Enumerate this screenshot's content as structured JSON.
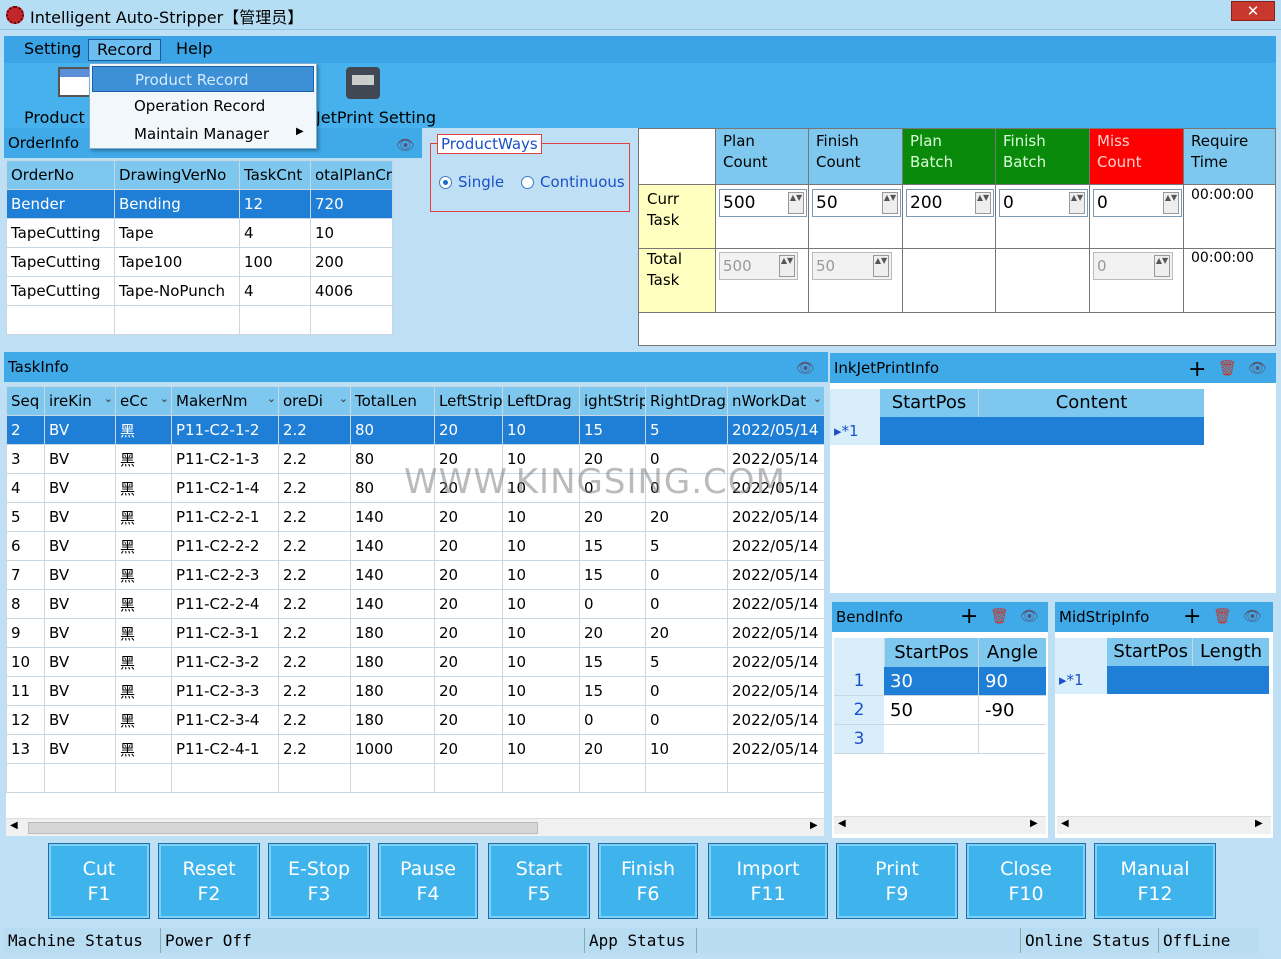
{
  "window": {
    "title": "Intelligent Auto-Stripper【管理员】",
    "close": "✕"
  },
  "menu": {
    "setting": "Setting",
    "record": "Record",
    "help": "Help"
  },
  "dropdown": {
    "items": [
      "Product Record",
      "Operation Record",
      "Maintain Manager"
    ]
  },
  "toolbar": {
    "product_label": "Product T",
    "inkjet_label": "JetPrint Setting"
  },
  "order": {
    "title": "OrderInfo",
    "columns": [
      "OrderNo",
      "DrawingVerNo",
      "TaskCnt",
      "otalPlanCr"
    ],
    "rows": [
      [
        "Bender",
        "Bending",
        "12",
        "720"
      ],
      [
        "TapeCutting",
        "Tape",
        "4",
        "10"
      ],
      [
        "TapeCutting",
        "Tape100",
        "100",
        "200"
      ],
      [
        "TapeCutting",
        "Tape-NoPunch",
        "4",
        "4006"
      ]
    ]
  },
  "productways": {
    "title": "ProductWays",
    "single": "Single",
    "continuous": "Continuous"
  },
  "counts": {
    "headers": [
      "Plan Count",
      "Finish Count",
      "Plan Batch",
      "Finish Batch",
      "Miss Count",
      "Require Time"
    ],
    "curr_label": "Curr Task",
    "total_label": "Total Task",
    "curr": [
      "500",
      "50",
      "200",
      "0",
      "0",
      "00:00:00"
    ],
    "total": [
      "500",
      "50",
      "0",
      "00:00:00"
    ],
    "colors": {
      "plan_batch": "#0a8a0a",
      "finish_batch": "#0a8a0a",
      "miss": "#ff0000"
    }
  },
  "task": {
    "title": "TaskInfo",
    "columns": [
      "Seq",
      "ireKin",
      "eCc",
      "MakerNm",
      "oreDi",
      "TotalLen",
      "LeftStrip",
      "LeftDrag",
      "ightStrip",
      "RightDrag",
      "nWorkDat"
    ],
    "rows": [
      [
        "2",
        "BV",
        "黑",
        "P11-C2-1-2",
        "2.2",
        "80",
        "20",
        "10",
        "15",
        "5",
        "2022/05/14"
      ],
      [
        "3",
        "BV",
        "黑",
        "P11-C2-1-3",
        "2.2",
        "80",
        "20",
        "10",
        "20",
        "0",
        "2022/05/14"
      ],
      [
        "4",
        "BV",
        "黑",
        "P11-C2-1-4",
        "2.2",
        "80",
        "20",
        "10",
        "0",
        "0",
        "2022/05/14"
      ],
      [
        "5",
        "BV",
        "黑",
        "P11-C2-2-1",
        "2.2",
        "140",
        "20",
        "10",
        "20",
        "20",
        "2022/05/14"
      ],
      [
        "6",
        "BV",
        "黑",
        "P11-C2-2-2",
        "2.2",
        "140",
        "20",
        "10",
        "15",
        "5",
        "2022/05/14"
      ],
      [
        "7",
        "BV",
        "黑",
        "P11-C2-2-3",
        "2.2",
        "140",
        "20",
        "10",
        "15",
        "0",
        "2022/05/14"
      ],
      [
        "8",
        "BV",
        "黑",
        "P11-C2-2-4",
        "2.2",
        "140",
        "20",
        "10",
        "0",
        "0",
        "2022/05/14"
      ],
      [
        "9",
        "BV",
        "黑",
        "P11-C2-3-1",
        "2.2",
        "180",
        "20",
        "10",
        "20",
        "20",
        "2022/05/14"
      ],
      [
        "10",
        "BV",
        "黑",
        "P11-C2-3-2",
        "2.2",
        "180",
        "20",
        "10",
        "15",
        "5",
        "2022/05/14"
      ],
      [
        "11",
        "BV",
        "黑",
        "P11-C2-3-3",
        "2.2",
        "180",
        "20",
        "10",
        "15",
        "0",
        "2022/05/14"
      ],
      [
        "12",
        "BV",
        "黑",
        "P11-C2-3-4",
        "2.2",
        "180",
        "20",
        "10",
        "0",
        "0",
        "2022/05/14"
      ],
      [
        "13",
        "BV",
        "黑",
        "P11-C2-4-1",
        "2.2",
        "1000",
        "20",
        "10",
        "20",
        "10",
        "2022/05/14"
      ]
    ]
  },
  "inkjet": {
    "title": "InkJetPrintInfo",
    "columns": [
      "StartPos",
      "Content"
    ],
    "row_marker": "1"
  },
  "bend": {
    "title": "BendInfo",
    "columns": [
      "StartPos",
      "Angle"
    ],
    "rows": [
      [
        "1",
        "30",
        "90"
      ],
      [
        "2",
        "50",
        "-90"
      ],
      [
        "3",
        "",
        ""
      ]
    ]
  },
  "midstrip": {
    "title": "MidStripInfo",
    "columns": [
      "StartPos",
      "Length"
    ],
    "row_marker": "1"
  },
  "buttons": [
    [
      "Cut",
      "F1"
    ],
    [
      "Reset",
      "F2"
    ],
    [
      "E-Stop",
      "F3"
    ],
    [
      "Pause",
      "F4"
    ],
    [
      "Start",
      "F5"
    ],
    [
      "Finish",
      "F6"
    ],
    [
      "Import",
      "F11"
    ],
    [
      "Print",
      "F9"
    ],
    [
      "Close",
      "F10"
    ],
    [
      "Manual",
      "F12"
    ]
  ],
  "status": {
    "machine_label": "Machine Status",
    "machine_value": "Power Off",
    "app_label": "App Status",
    "online_label": "Online Status",
    "online_value": "OffLine"
  },
  "watermark": "WWW.KINGSING.COM"
}
